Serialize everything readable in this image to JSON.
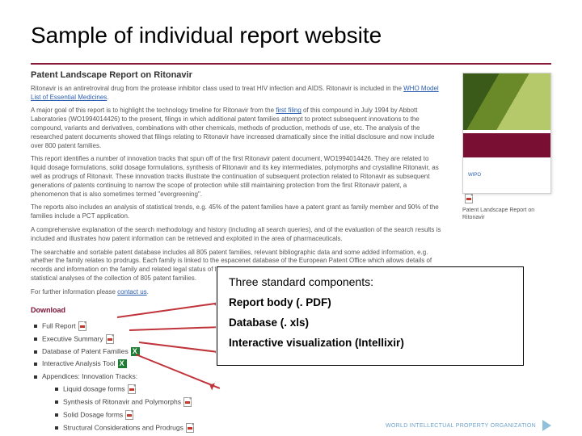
{
  "slide_title": "Sample of individual report website",
  "page": {
    "heading": "Patent Landscape Report on Ritonavir",
    "p1_a": "Ritonavir is an antiretroviral drug from the protease inhibitor class used to treat HIV infection and AIDS. Ritonavir is included in the ",
    "p1_link": "WHO Model List of Essential Medicines",
    "p1_b": ".",
    "p2_a": "A major goal of this report is to highlight the technology timeline for Ritonavir from the ",
    "p2_link": "first filing",
    "p2_b": " of this compound in July 1994 by Abbott Laboratories (WO1994014426) to the present, filings in which additional patent families attempt to protect subsequent innovations to the compound, variants and derivatives, combinations with other chemicals, methods of production, methods of use, etc. The analysis of the researched patent documents showed that filings relating to Ritonavir have increased dramatically since the initial disclosure and now include over 800 patent families.",
    "p3": "This report identifies a number of innovation tracks that spun off of the first Ritonavir patent document, WO1994014426. They are related to liquid dosage formulations, solid dosage formulations, synthesis of Ritonavir and its key intermediates, polymorphs and crystalline Ritonavir, as well as prodrugs of Ritonavir. These innovation tracks illustrate the continuation of subsequent protection related to Ritonavir as subsequent generations of patents continuing to narrow the scope of protection while still maintaining protection from the first Ritonavir patent, a phenomenon that is also sometimes termed \"evergreening\".",
    "p4": "The reports also includes an analysis of statistical trends, e.g. 45% of the patent families have a patent grant as family member and 90% of the families include a PCT application.",
    "p5": "A comprehensive explanation of the search methodology and history (including all search queries), and of the evaluation of the search results is included and illustrates how patent information can be retrieved and exploited in the area of pharmaceuticals.",
    "p6": "The searchable and sortable patent database includes all 805 patent families, relevant bibliographic data and some added information, e.g. whether the family relates to prodrugs. Each family is linked to the espacenet database of the European Patent Office which allows details of records and information on the family and related legal status of family members. The database is complemented by a visualization of various statistical analyses of the collection of 805 patent families.",
    "p7_a": "For further information please ",
    "p7_link": "contact us",
    "p7_b": "."
  },
  "thumb_caption": "Patent Landscape Report on Ritonavir",
  "download": {
    "heading": "Download",
    "items": {
      "full": "Full Report",
      "exec": "Executive Summary",
      "db": "Database of Patent Families",
      "tool": "Interactive Analysis Tool",
      "appx": "Appendices: Innovation Tracks:",
      "liq": "Liquid dosage forms",
      "syn": "Synthesis of Ritonavir and Polymorphs",
      "sol": "Solid Dosage forms",
      "struct": "Structural Considerations and Prodrugs"
    }
  },
  "overlay": {
    "heading": "Three standard components:",
    "r1": "Report body (. PDF)",
    "r2": "Database (. xls)",
    "r3": "Interactive visualization (Intellixir)"
  },
  "footer": "WORLD INTELLECTUAL PROPERTY ORGANIZATION"
}
